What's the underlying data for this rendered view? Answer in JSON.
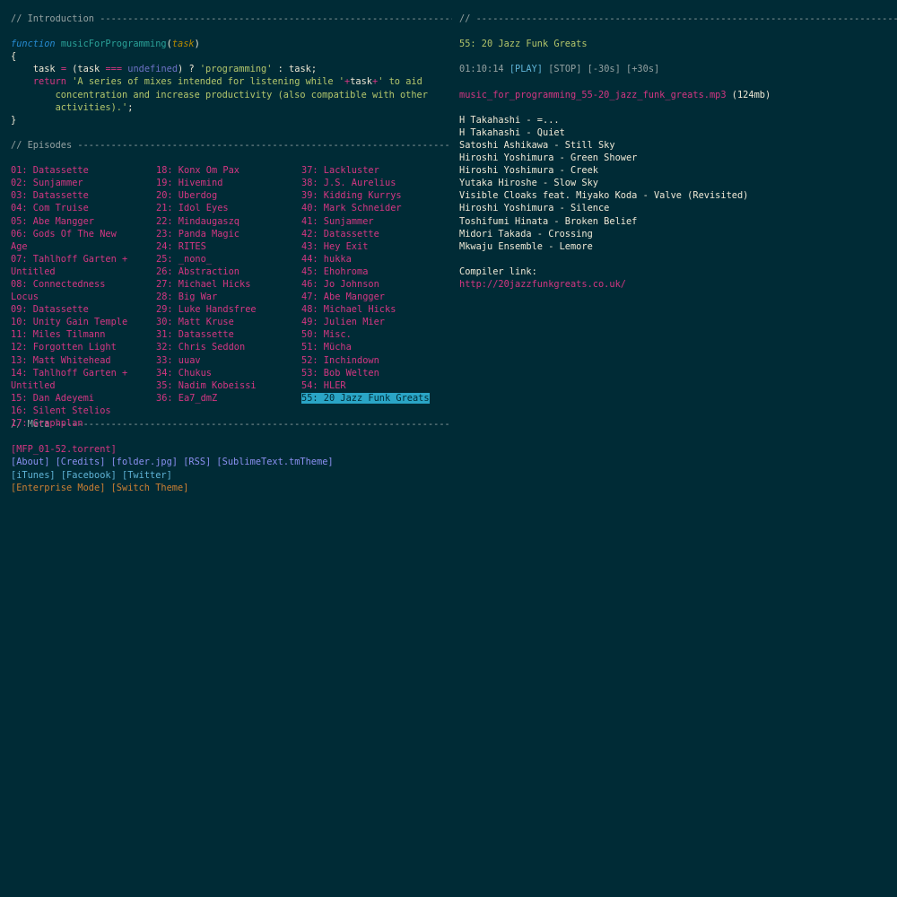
{
  "intro": {
    "heading": "// Introduction -----------------------------------------------------------------",
    "code": {
      "function_kw": "function",
      "function_name": "musicForProgramming",
      "param": "task",
      "brace_open": "{",
      "brace_close": "}",
      "line2_var": "task",
      "line2_eq": "=",
      "line2_paren": "(task",
      "line2_cmp": "===",
      "line2_undef": "undefined",
      "line2_q": ") ?",
      "line2_str": "'programming'",
      "line2_tail": ": task;",
      "ret_kw": "return",
      "ret_str1": "'A series of mixes intended for listening while '",
      "ret_plus1": "+",
      "ret_task": "task",
      "ret_plus2": "+",
      "ret_str2": "' to aid",
      "ret_str3": "concentration and increase productivity (also compatible with other",
      "ret_str4": "activities).'",
      "ret_semi": ";"
    }
  },
  "episodes": {
    "heading": "// Episodes -------------------------------------------------------------------",
    "col1": [
      "01: Datassette",
      "02: Sunjammer",
      "03: Datassette",
      "04: Com Truise",
      "05: Abe Mangger",
      "06: Gods Of The New Age",
      "07: Tahlhoff Garten + Untitled",
      "08: Connectedness Locus",
      "09: Datassette",
      "10: Unity Gain Temple",
      "11: Miles Tilmann",
      "12: Forgotten Light",
      "13: Matt Whitehead",
      "14: Tahlhoff Garten + Untitled",
      "15: Dan Adeyemi",
      "16: Silent Stelios",
      "17: Graphplan"
    ],
    "col2": [
      "18: Konx Om Pax",
      "19: Hivemind",
      "20: Uberdog",
      "21: Idol Eyes",
      "22: Mindaugaszq",
      "23: Panda Magic",
      "24: RITES",
      "25: _nono_",
      "26: Abstraction",
      "27: Michael Hicks",
      "28: Big War",
      "29: Luke Handsfree",
      "30: Matt Kruse",
      "31: Datassette",
      "32: Chris Seddon",
      "33: uuav",
      "34: Chukus",
      "35: Nadim Kobeissi",
      "36: Ea7_dmZ"
    ],
    "col3": [
      "37: Lackluster",
      "38: J.S. Aurelius",
      "39: Kidding Kurrys",
      "40: Mark Schneider",
      "41: Sunjammer",
      "42: Datassette",
      "43: Hey Exit",
      "44: hukka",
      "45: Ehohroma",
      "46: Jo Johnson",
      "47: Abe Mangger",
      "48: Michael Hicks",
      "49: Julien Mier",
      "50: Misc.",
      "51: Mücha",
      "52: Inchindown",
      "53: Bob Welten",
      "54: HLER",
      "55: 20 Jazz Funk Greats"
    ],
    "selected": "55: 20 Jazz Funk Greats"
  },
  "meta": {
    "heading": "// Meta -----------------------------------------------------------------------",
    "torrent": "[MFP_01-52.torrent]",
    "about": "[About]",
    "credits": "[Credits]",
    "folder": "[folder.jpg]",
    "rss": "[RSS]",
    "theme_file": "[SublimeText.tmTheme]",
    "itunes": "[iTunes]",
    "facebook": "[Facebook]",
    "twitter": "[Twitter]",
    "enterprise": "[Enterprise Mode]",
    "switch_theme": "[Switch Theme]"
  },
  "player": {
    "heading": "// -----------------------------------------------------------------------------",
    "title": "55: 20 Jazz Funk Greats",
    "time": "01:10:14",
    "play": "[PLAY]",
    "stop": "[STOP]",
    "back": "[-30s]",
    "forward": "[+30s]",
    "file": "music_for_programming_55-20_jazz_funk_greats.mp3",
    "size": "(124mb)",
    "tracks": [
      "H Takahashi - =...",
      "H Takahashi - Quiet",
      "Satoshi Ashikawa - Still Sky",
      "Hiroshi Yoshimura - Green Shower",
      "Hiroshi Yoshimura - Creek",
      "Yutaka Hiroshe - Slow Sky",
      "Visible Cloaks feat. Miyako Koda - Valve (Revisited)",
      "Hiroshi Yoshimura - Silence",
      "Toshifumi Hinata - Broken Belief",
      "Midori Takada - Crossing",
      "Mkwaju Ensemble - Lemore"
    ],
    "compiler_label": "Compiler link:",
    "compiler_url": "http://20jazzfunkgreats.co.uk/"
  },
  "colors": {
    "background": "#002b36",
    "link_pink": "#d33682",
    "now_playing_green": "#b3c46a",
    "selected_bg": "#2aa5c6"
  }
}
